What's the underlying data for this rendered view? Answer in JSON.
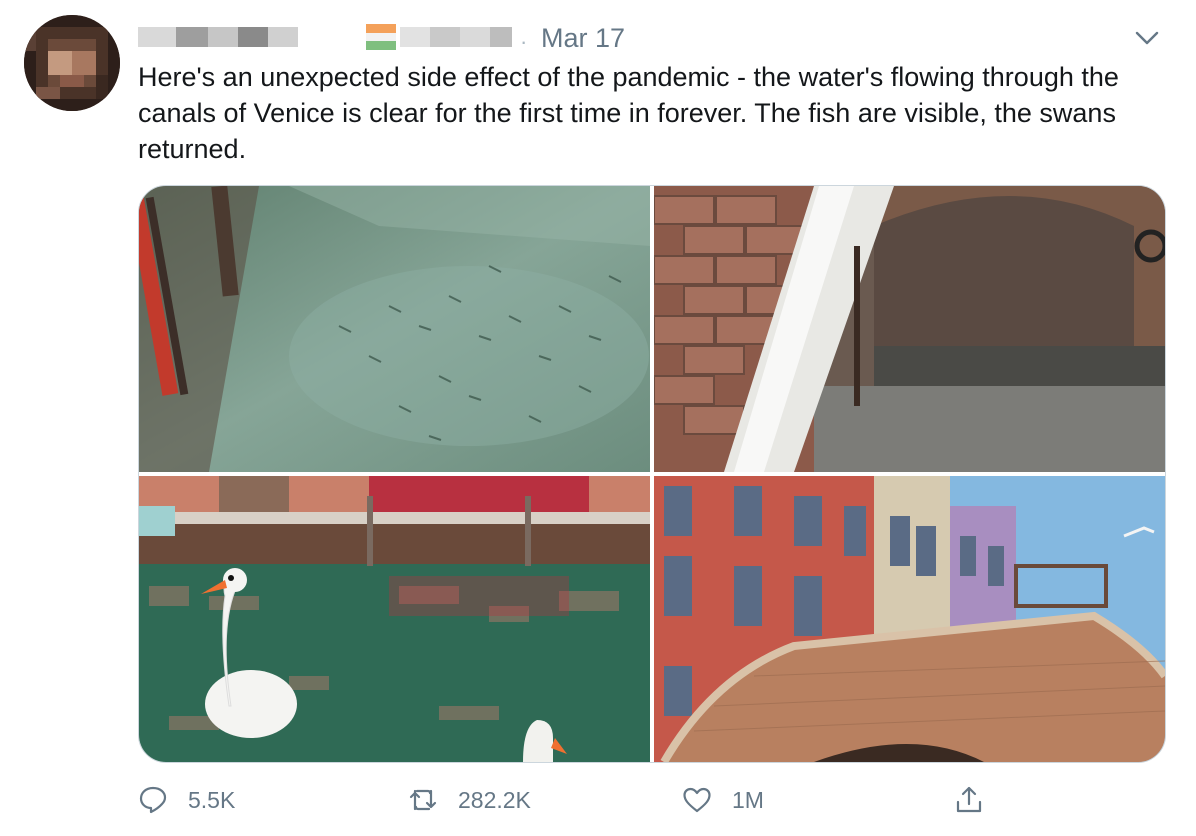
{
  "tweet": {
    "date": "Mar 17",
    "separator": "·",
    "text": "Here's an unexpected side effect of the pandemic - the water's flowing through the canals of Venice is clear for the first time in forever. The fish are visible, the swans returned.",
    "icons": {
      "menu": "chevron-down-icon",
      "reply": "speech-bubble-icon",
      "retweet": "retweet-arrows-icon",
      "like": "heart-icon",
      "share": "share-upload-icon"
    },
    "actions": {
      "replies": "5.5K",
      "retweets": "282.2K",
      "likes": "1M"
    },
    "colors": {
      "text": "#14171a",
      "secondary": "#657786",
      "border": "#ccd6dd"
    }
  }
}
